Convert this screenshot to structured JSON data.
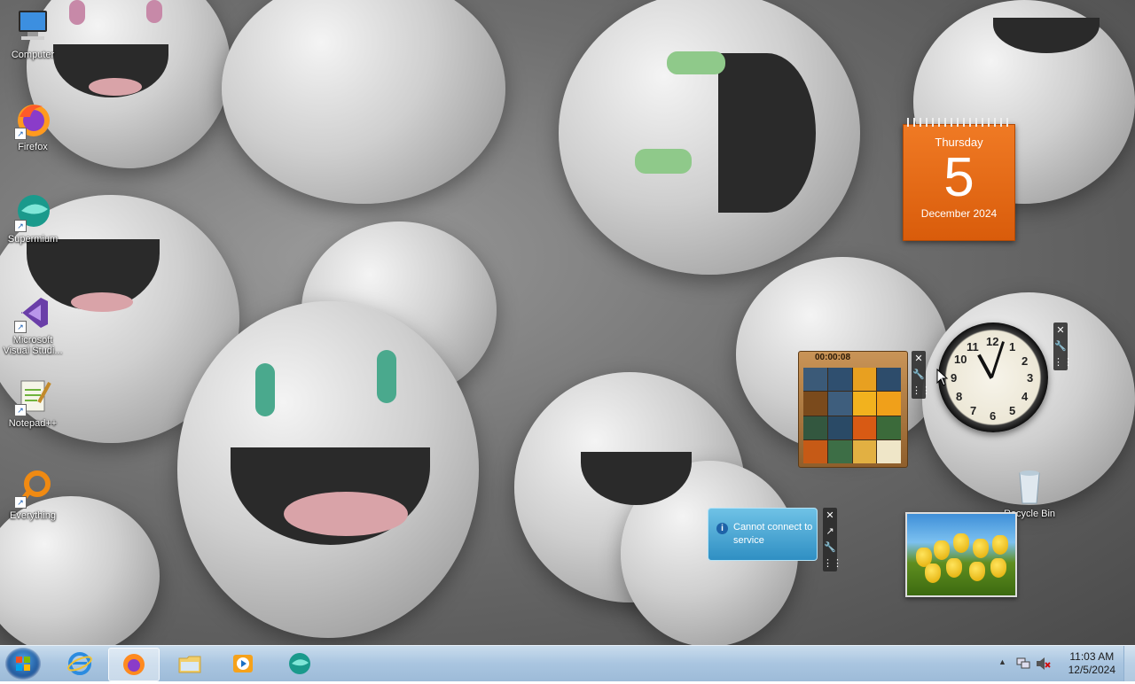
{
  "desktop_icons": [
    {
      "label": "Computer",
      "icon": "computer-icon"
    },
    {
      "label": "Firefox",
      "icon": "firefox-icon"
    },
    {
      "label": "Supermium",
      "icon": "supermium-icon"
    },
    {
      "label": "Microsoft Visual Studi...",
      "icon": "visual-studio-icon"
    },
    {
      "label": "Notepad++",
      "icon": "notepadpp-icon"
    },
    {
      "label": "Everything",
      "icon": "everything-icon"
    },
    {
      "label": "Recycle Bin",
      "icon": "recycle-bin-icon"
    }
  ],
  "calendar": {
    "weekday": "Thursday",
    "day": "5",
    "month_year": "December 2024"
  },
  "clock": {
    "numbers": [
      "12",
      "1",
      "2",
      "3",
      "4",
      "5",
      "6",
      "7",
      "8",
      "9",
      "10",
      "11"
    ],
    "hour": 11,
    "minute": 3
  },
  "puzzle": {
    "timer": "00:00:08"
  },
  "feed": {
    "message": "Cannot connect to service"
  },
  "gadget_controls": {
    "close": "✕",
    "options": "🔧",
    "grip": "⋮⋮",
    "size": "↗"
  },
  "taskbar": {
    "pinned": [
      {
        "name": "Internet Explorer",
        "icon": "ie-icon",
        "active": false
      },
      {
        "name": "Firefox",
        "icon": "firefox-icon",
        "active": true
      },
      {
        "name": "Windows Explorer",
        "icon": "folder-icon",
        "active": false
      },
      {
        "name": "Windows Media Player",
        "icon": "media-player-icon",
        "active": false
      },
      {
        "name": "Supermium",
        "icon": "supermium-icon",
        "active": false
      }
    ],
    "tray": {
      "show_hidden": "▲",
      "time": "11:03 AM",
      "date": "12/5/2024"
    }
  },
  "colors": {
    "calendar": "#e8701c",
    "taskbar": "#b6cfe6",
    "feed": "#4aa8d8"
  }
}
